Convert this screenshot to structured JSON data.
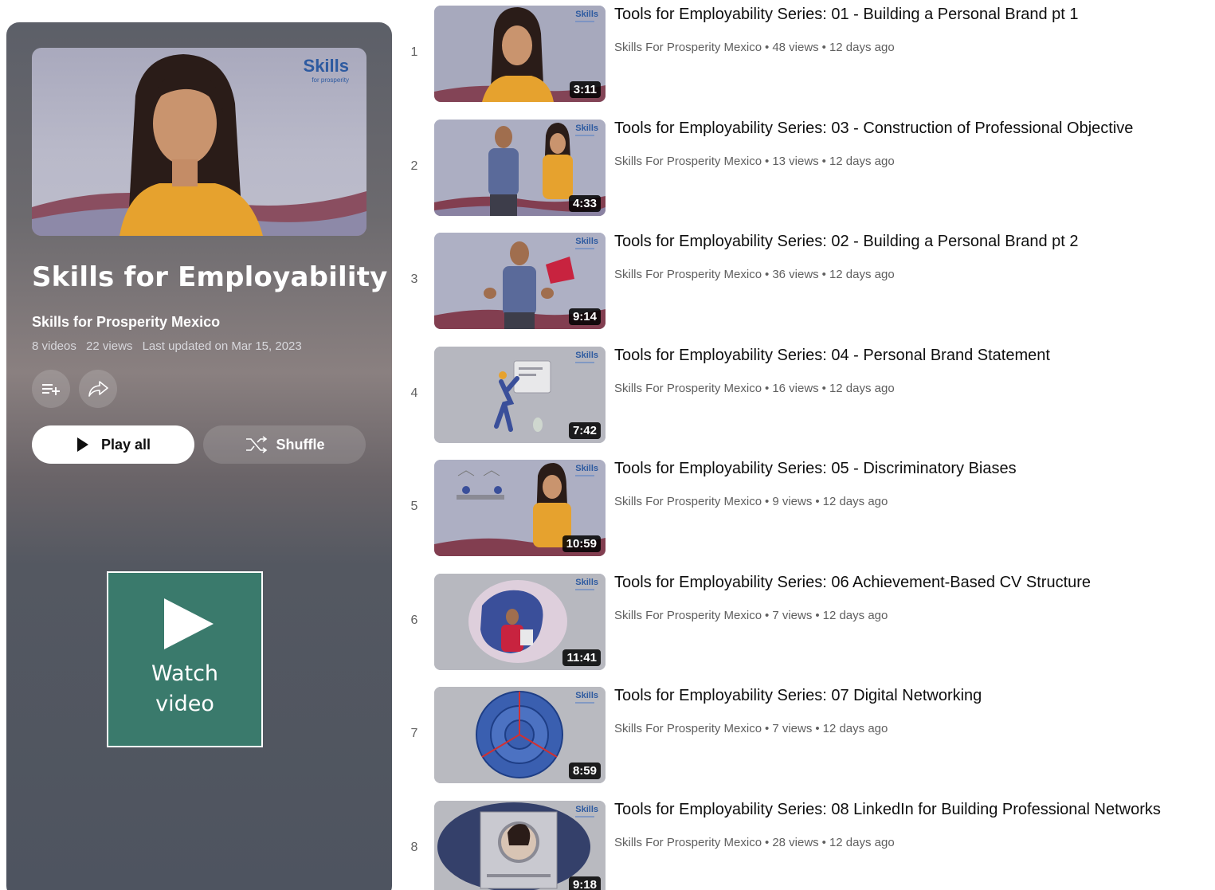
{
  "playlist": {
    "hero_brand": "Skills",
    "hero_brand_sub": "for prosperity",
    "title": "Skills for Employability",
    "owner": "Skills for Prosperity Mexico",
    "video_count": "8 videos",
    "views": "22 views",
    "updated": "Last updated on Mar 15, 2023",
    "play_all_label": "Play all",
    "shuffle_label": "Shuffle",
    "watch_label": "Watch video"
  },
  "icons": [
    "add-to-queue-icon",
    "share-icon",
    "play-icon",
    "shuffle-icon"
  ],
  "videos": [
    {
      "index": "1",
      "title": "Tools for Employability Series: 01 - Building a Personal Brand pt 1",
      "channel": "Skills For Prosperity Mexico",
      "views": "48 views",
      "age": "12 days ago",
      "duration": "3:11",
      "brand": "Skills"
    },
    {
      "index": "2",
      "title": "Tools for Employability Series: 03 - Construction of Professional Objective",
      "channel": "Skills For Prosperity Mexico",
      "views": "13 views",
      "age": "12 days ago",
      "duration": "4:33",
      "brand": "Skills"
    },
    {
      "index": "3",
      "title": "Tools for Employability Series: 02 - Building a Personal Brand pt 2",
      "channel": "Skills For Prosperity Mexico",
      "views": "36 views",
      "age": "12 days ago",
      "duration": "9:14",
      "brand": "Skills"
    },
    {
      "index": "4",
      "title": "Tools for Employability Series: 04 - Personal Brand Statement",
      "channel": "Skills For Prosperity Mexico",
      "views": "16 views",
      "age": "12 days ago",
      "duration": "7:42",
      "brand": "Skills"
    },
    {
      "index": "5",
      "title": "Tools for Employability Series: 05 - Discriminatory Biases",
      "channel": "Skills For Prosperity Mexico",
      "views": "9 views",
      "age": "12 days ago",
      "duration": "10:59",
      "brand": "Skills"
    },
    {
      "index": "6",
      "title": "Tools for Employability Series: 06 Achievement-Based CV Structure",
      "channel": "Skills For Prosperity Mexico",
      "views": "7 views",
      "age": "12 days ago",
      "duration": "11:41",
      "brand": "Skills"
    },
    {
      "index": "7",
      "title": "Tools for Employability Series: 07 Digital Networking",
      "channel": "Skills For Prosperity Mexico",
      "views": "7 views",
      "age": "12 days ago",
      "duration": "8:59",
      "brand": "Skills"
    },
    {
      "index": "8",
      "title": "Tools for Employability Series: 08 LinkedIn for Building Professional Networks",
      "channel": "Skills For Prosperity Mexico",
      "views": "28 views",
      "age": "12 days ago",
      "duration": "9:18",
      "brand": "Skills"
    }
  ],
  "colors": {
    "watch_box": "#3a7a6c",
    "panel_top": "#5c5f68",
    "brand_blue": "#2d5aa0"
  }
}
